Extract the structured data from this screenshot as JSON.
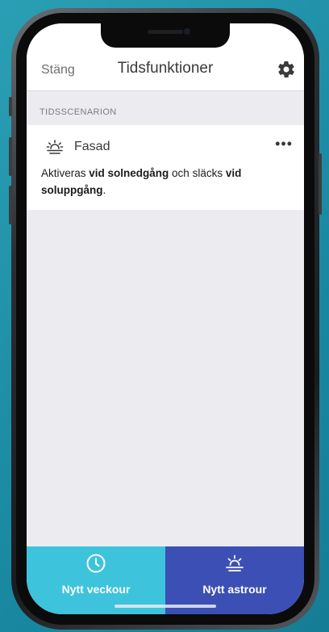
{
  "navbar": {
    "close_label": "Stäng",
    "title": "Tidsfunktioner",
    "settings_icon": "gear-icon"
  },
  "section": {
    "header": "TIDSSCENARION"
  },
  "scenario": {
    "icon": "sunset-icon",
    "name": "Fasad",
    "more": "•••",
    "desc_prefix": "Aktiveras ",
    "desc_on": "vid solnedgång",
    "desc_middle": " och släcks ",
    "desc_off": "vid soluppgång",
    "desc_suffix": "."
  },
  "bottom_tabs": [
    {
      "label": "Nytt veckour",
      "icon": "clock-icon",
      "color": "#3ec3dc"
    },
    {
      "label": "Nytt astrour",
      "icon": "sunrise-icon",
      "color": "#3c4fb5"
    }
  ],
  "colors": {
    "background": "#1b8aa3",
    "screen_bg": "#ececf0",
    "week_tab": "#3ec3dc",
    "astro_tab": "#3c4fb5"
  }
}
